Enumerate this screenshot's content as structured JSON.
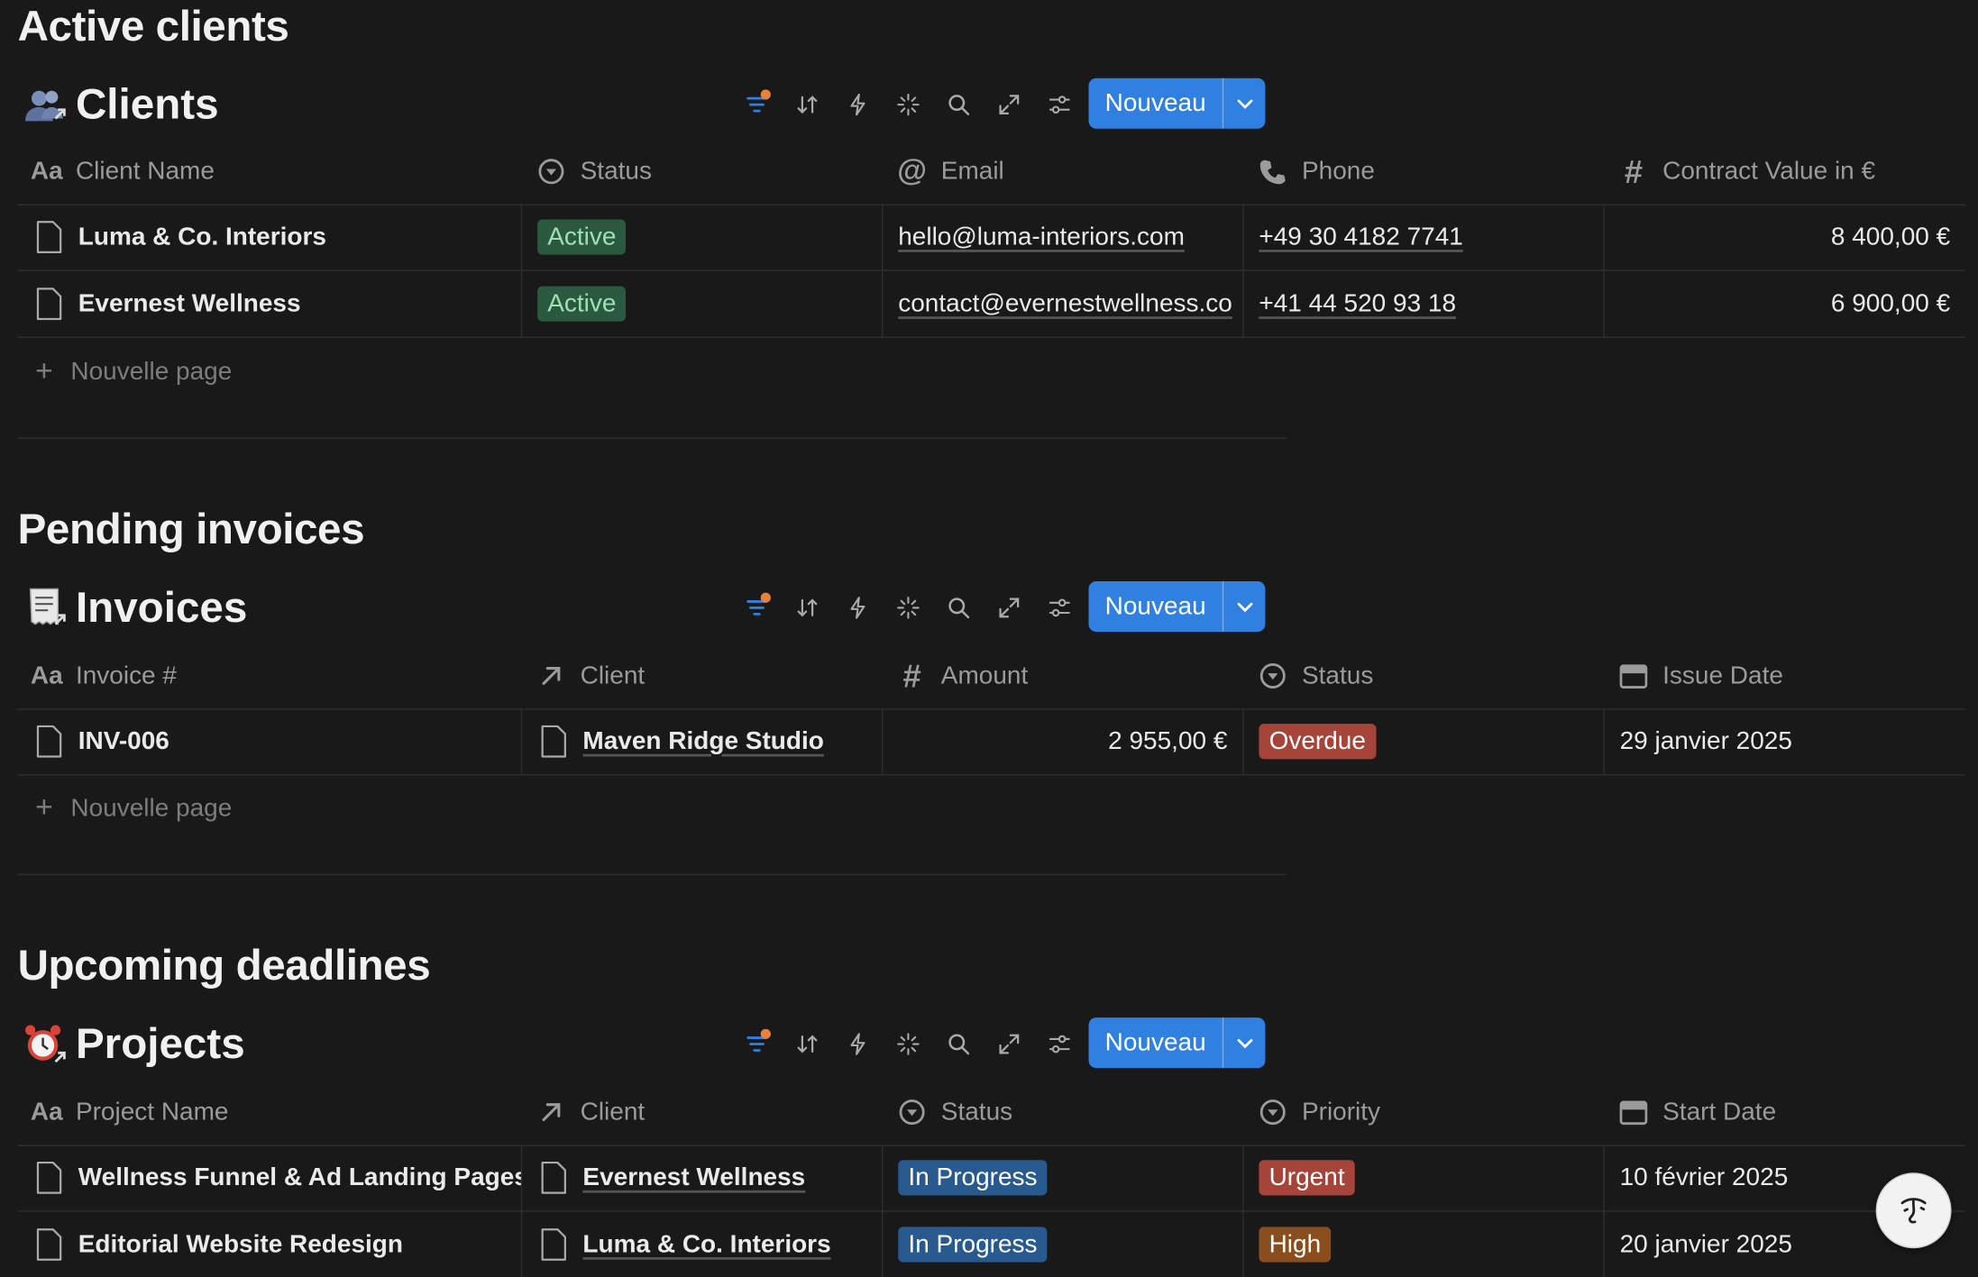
{
  "clients_section": {
    "title": "Active clients",
    "db_title": "Clients",
    "new_label": "Nouveau",
    "columns": [
      "Client Name",
      "Status",
      "Email",
      "Phone",
      "Contract Value in €"
    ],
    "rows": [
      {
        "name": "Luma & Co. Interiors",
        "status": "Active",
        "email": "hello@luma-interiors.com",
        "phone": "+49 30 4182 7741",
        "value": "8 400,00 €"
      },
      {
        "name": "Evernest Wellness",
        "status": "Active",
        "email": "contact@evernestwellness.co",
        "phone": "+41 44 520 93 18",
        "value": "6 900,00 €"
      }
    ],
    "new_page": "Nouvelle page"
  },
  "invoices_section": {
    "title": "Pending invoices",
    "db_title": "Invoices",
    "new_label": "Nouveau",
    "columns": [
      "Invoice #",
      "Client",
      "Amount",
      "Status",
      "Issue Date"
    ],
    "rows": [
      {
        "invoice": "INV-006",
        "client": "Maven Ridge Studio",
        "amount": "2 955,00 €",
        "status": "Overdue",
        "date": "29 janvier 2025"
      }
    ],
    "new_page": "Nouvelle page"
  },
  "projects_section": {
    "title": "Upcoming deadlines",
    "db_title": "Projects",
    "new_label": "Nouveau",
    "columns": [
      "Project Name",
      "Client",
      "Status",
      "Priority",
      "Start Date"
    ],
    "rows": [
      {
        "name": "Wellness Funnel & Ad Landing Pages",
        "client": "Evernest Wellness",
        "status": "In Progress",
        "priority": "Urgent",
        "date": "10 février 2025"
      },
      {
        "name": "Editorial Website Redesign",
        "client": "Luma & Co. Interiors",
        "status": "In Progress",
        "priority": "High",
        "date": "20 janvier 2025"
      }
    ]
  },
  "colors": {
    "active_tag_bg": "#2b593f",
    "active_tag_fg": "#9ee0b4",
    "overdue_tag_bg": "#a6443a",
    "inprogress_tag_bg": "#285a8f",
    "urgent_tag_bg": "#a6443a",
    "high_tag_bg": "#8a4e1e",
    "accent": "#2f80e1"
  }
}
